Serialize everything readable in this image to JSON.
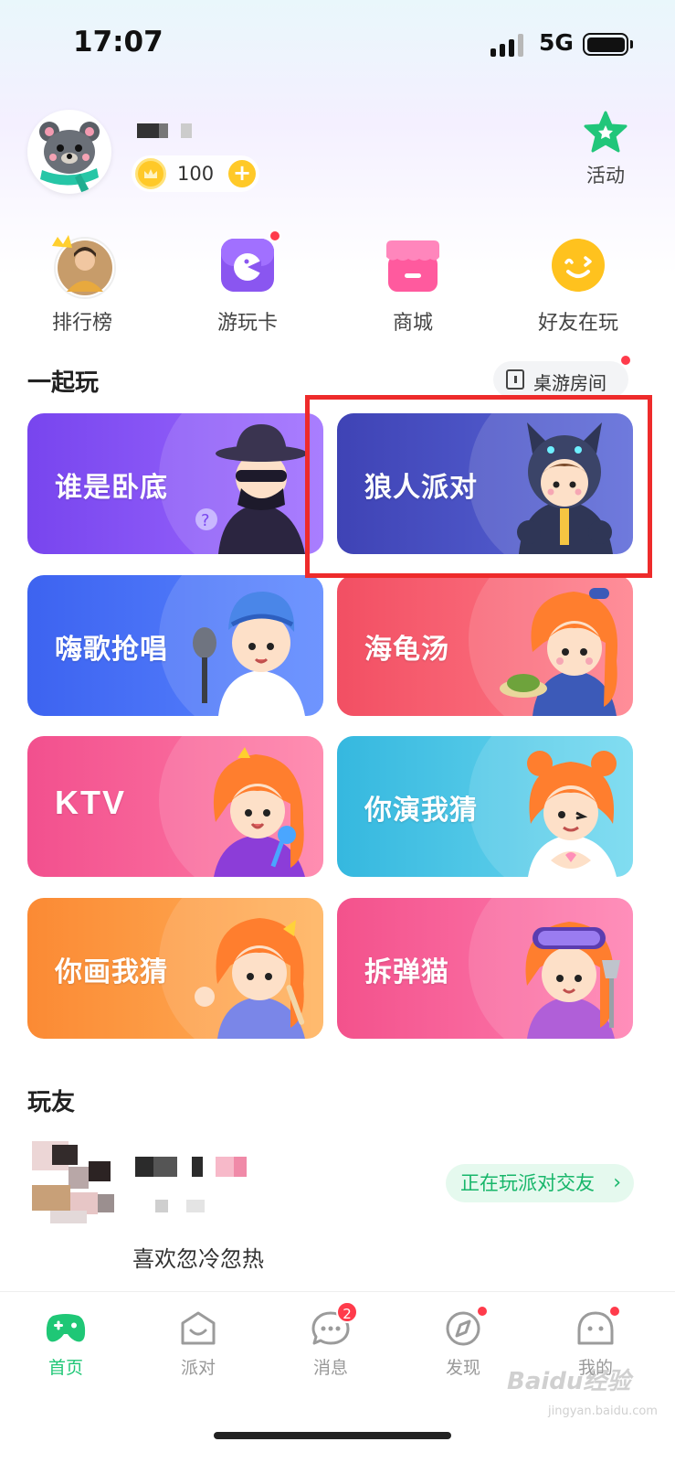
{
  "status_bar": {
    "time": "17:07",
    "network": "5G"
  },
  "profile": {
    "coins": "100",
    "coin_add": "+"
  },
  "activity": {
    "label": "活动",
    "icon": "star-icon"
  },
  "quick_actions": [
    {
      "label": "排行榜",
      "icon": "crown-avatar-icon"
    },
    {
      "label": "游玩卡",
      "icon": "game-card-icon"
    },
    {
      "label": "商城",
      "icon": "shop-icon"
    },
    {
      "label": "好友在玩",
      "icon": "smile-icon"
    }
  ],
  "play_section": {
    "title": "一起玩",
    "board_room_label": "桌游房间",
    "games": [
      {
        "label": "谁是卧底",
        "color": "#7a52f2"
      },
      {
        "label": "狼人派对",
        "color": "#4b55c9"
      },
      {
        "label": "嗨歌抢唱",
        "color": "#4a6af0"
      },
      {
        "label": "海龟汤",
        "color": "#f45c6e"
      },
      {
        "label": "KTV",
        "color": "#f2558a"
      },
      {
        "label": "你演我猜",
        "color": "#3fbde0"
      },
      {
        "label": "你画我猜",
        "color": "#fb8f3c"
      },
      {
        "label": "拆弹猫",
        "color": "#f5588e"
      }
    ]
  },
  "friends_section": {
    "title": "玩友",
    "friend": {
      "status": "喜欢忽冷忽热",
      "action": "正在玩派对交友",
      "action_chevron": "›"
    }
  },
  "tab_bar": {
    "tabs": [
      {
        "label": "首页",
        "active": true
      },
      {
        "label": "派对",
        "active": false
      },
      {
        "label": "消息",
        "active": false,
        "badge": "2"
      },
      {
        "label": "发现",
        "active": false
      },
      {
        "label": "我的",
        "active": false
      }
    ]
  },
  "watermark": {
    "text": "Baidu经验",
    "sub": "jingyan.baidu.com"
  },
  "colors": {
    "accent_green": "#1fc776",
    "highlight_red": "#ee2b2b"
  }
}
